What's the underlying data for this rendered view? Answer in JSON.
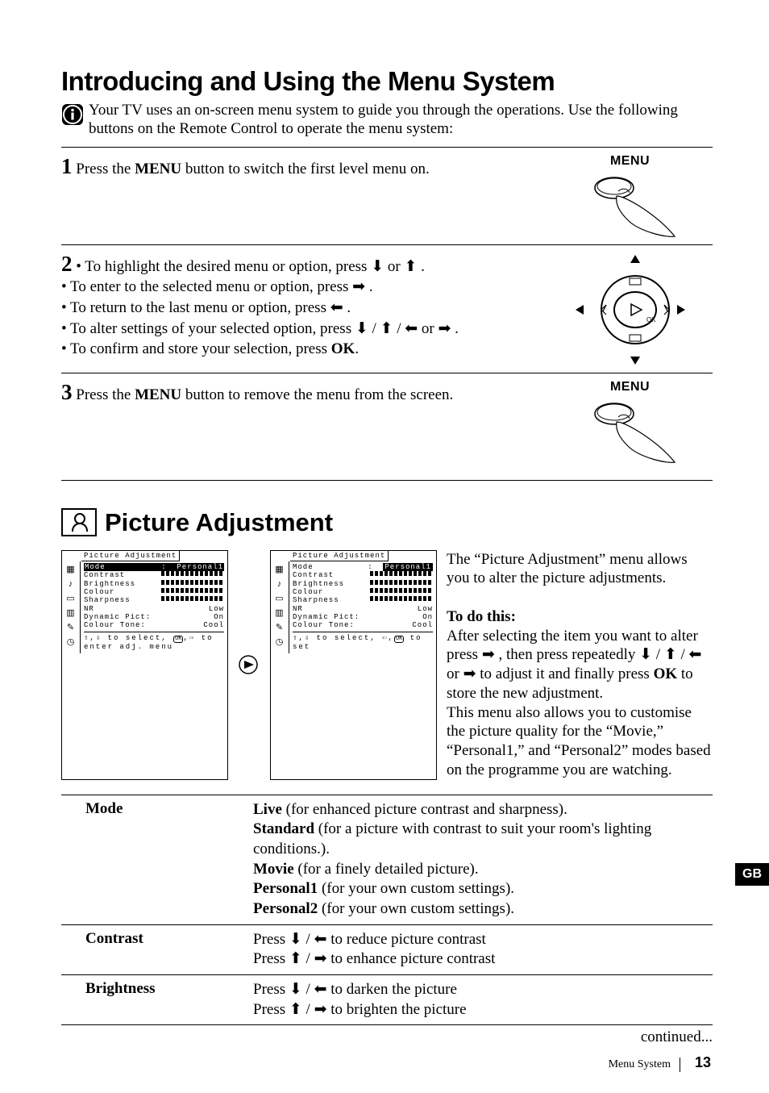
{
  "title": "Introducing and Using the Menu System",
  "intro": "Your TV uses an on-screen menu system to guide you through the operations. Use the following buttons on the Remote Control to operate the menu system:",
  "steps": {
    "s1_pre": "Press the ",
    "s1_btn": "MENU",
    "s1_post": " button to switch the first level menu on.",
    "s1_label": "MENU",
    "s2_a": "• To highlight the desired menu or option, press ",
    "s2_a2": " or ",
    "s2_a3": " .",
    "s2_b": "• To enter to the selected menu or option, press ",
    "s2_b2": " .",
    "s2_c": "• To return to the last menu or option, press ",
    "s2_c2": " .",
    "s2_d": "• To alter settings of your selected option, press ",
    "s2_d_sep": " / ",
    "s2_d_or": " or ",
    "s2_d_end": " .",
    "s2_e_pre": "• To confirm and store your selection, press ",
    "s2_e_btn": "OK",
    "s2_e_post": ".",
    "s3_pre": "Press the ",
    "s3_btn": "MENU",
    "s3_post": " button to remove the menu from the screen.",
    "s3_label": "MENU",
    "ok_label": "OK"
  },
  "section_title": "Picture Adjustment",
  "menu": {
    "title": "Picture Adjustment",
    "mode": "Mode",
    "mode_val1": "Personal1",
    "mode_val2": "Personal1",
    "contrast": "Contrast",
    "brightness": "Brightness",
    "colour": "Colour",
    "sharpness": "Sharpness",
    "nr": "NR",
    "nr_val": "Low",
    "dyn": "Dynamic Pict:",
    "dyn_val": "On",
    "tone": "Colour Tone:",
    "tone_val": "Cool",
    "hint1_a": "to select,",
    "hint1_b": "to enter adj. menu",
    "hint2_a": "to select,",
    "hint2_b": "to set",
    "ok": "OK"
  },
  "pa_text": {
    "p1": "The “Picture Adjustment” menu allows you to alter the picture adjustments.",
    "todo": "To do this:",
    "p2a": "After selecting the item you want to alter press ",
    "p2b": " , then press repeatedly ",
    "sep": " / ",
    "or": " or ",
    "p2c": " to adjust it and finally press ",
    "okword": "OK",
    "p2d": " to store the new adjustment.",
    "p3": "This menu also allows you to customise the picture quality for the “Movie,” “Personal1,” and “Personal2” modes based on the programme you are watching."
  },
  "specs": {
    "mode_label": "Mode",
    "live_b": "Live",
    "live_t": " (for enhanced picture contrast and sharpness).",
    "std_b": "Standard",
    "std_t": " (for a picture with contrast to suit your room's lighting conditions.).",
    "mov_b": "Movie",
    "mov_t": " (for a finely detailed picture).",
    "p1_b": "Personal1",
    "p1_t": " (for your own custom settings).",
    "p2_b": "Personal2",
    "p2_t": " (for your own custom settings).",
    "contrast_label": "Contrast",
    "c_r1a": "Press ",
    "c_r1b": " to reduce picture contrast",
    "c_r2a": "Press ",
    "c_r2b": " to enhance picture contrast",
    "brightness_label": "Brightness",
    "b_r1a": "Press ",
    "b_r1b": " to darken the picture",
    "b_r2a": "Press ",
    "b_r2b": " to brighten the picture"
  },
  "continued": "continued...",
  "edge": "GB",
  "footer_label": "Menu System",
  "page_num": "13"
}
